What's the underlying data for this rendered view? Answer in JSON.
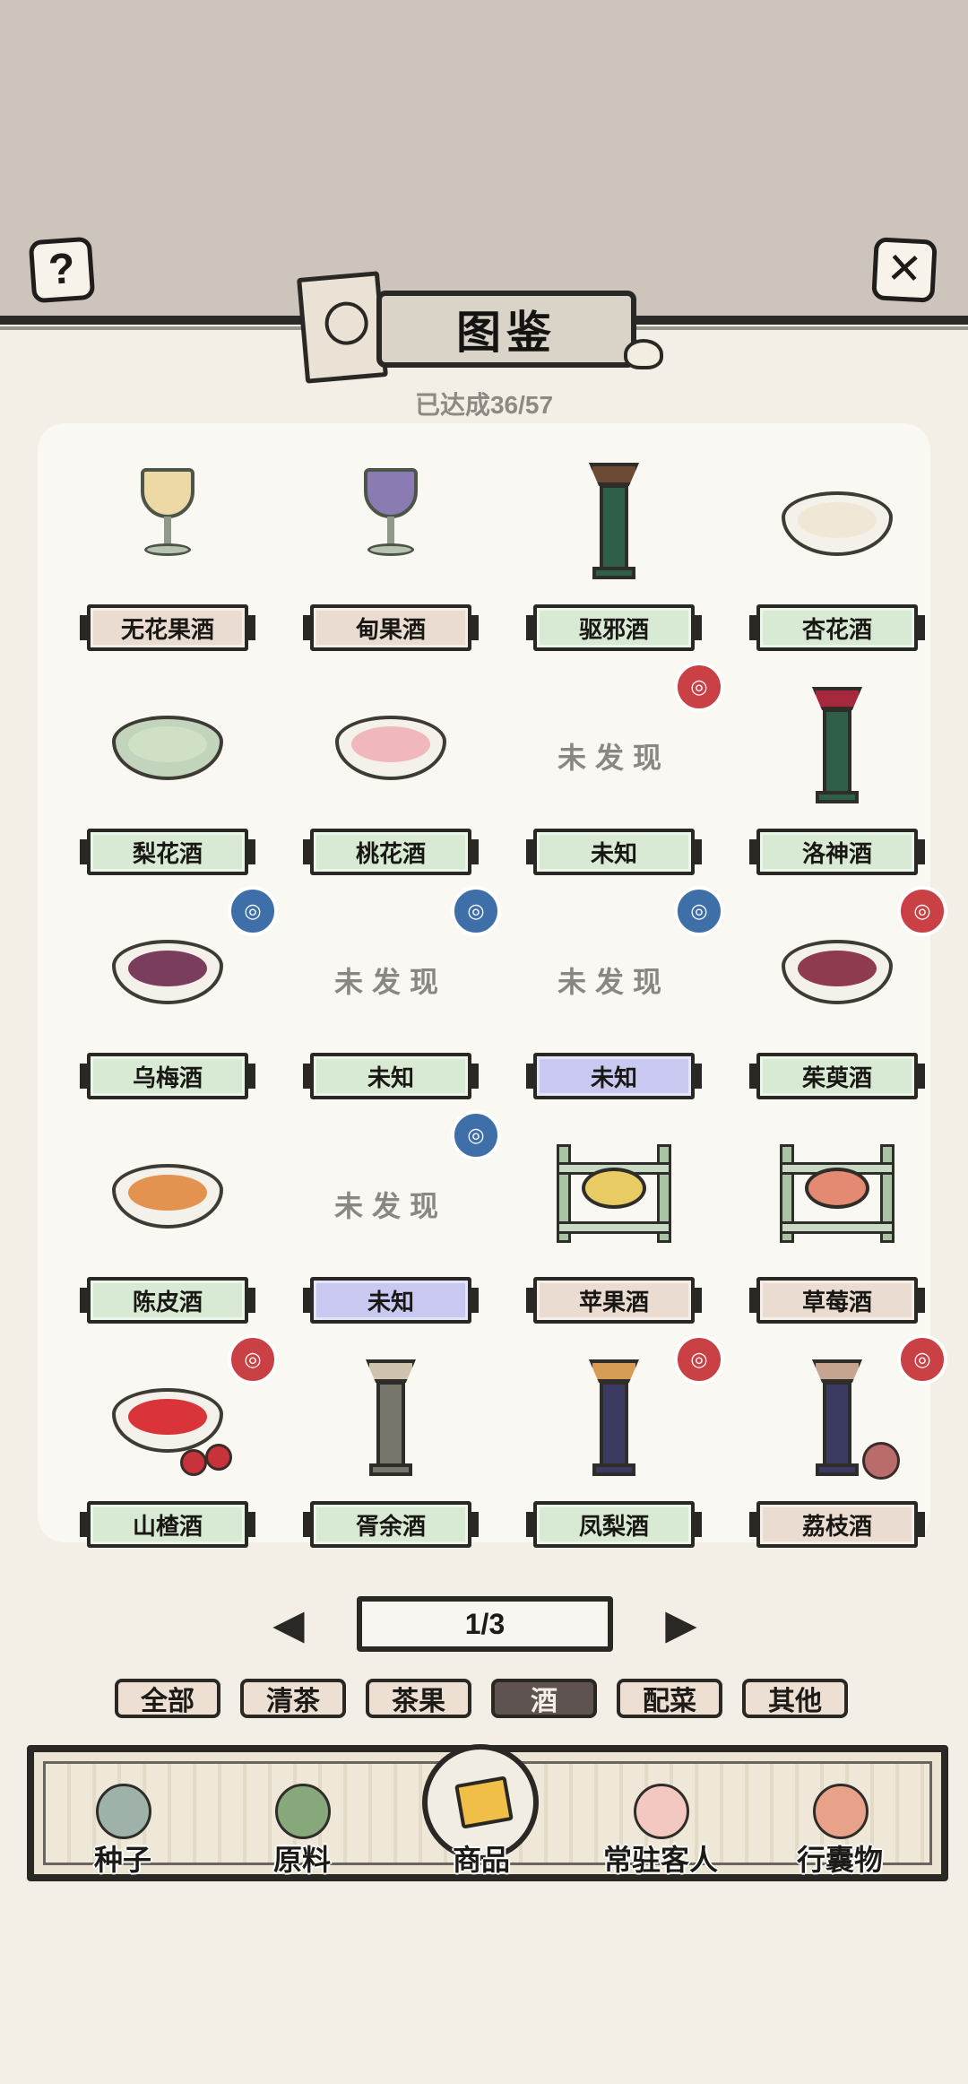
{
  "header": {
    "help_label": "?",
    "close_label": "✕",
    "title": "图鉴",
    "progress": "已达成36/57"
  },
  "grid": {
    "undiscovered_text": "未发现",
    "items": [
      {
        "name": "无花果酒",
        "plate": "brown",
        "icon": "goblet-icon",
        "liquid": "#ecd9a6",
        "badge": ""
      },
      {
        "name": "甸果酒",
        "plate": "brown",
        "icon": "goblet-icon",
        "liquid": "#8b7bb3",
        "badge": ""
      },
      {
        "name": "驱邪酒",
        "plate": "green",
        "icon": "vase-icon",
        "liquid": "#6c4a34",
        "badge": ""
      },
      {
        "name": "杏花酒",
        "plate": "green",
        "icon": "bowl-icon",
        "liquid": "#f1e7d6",
        "badge": ""
      },
      {
        "name": "梨花酒",
        "plate": "green",
        "icon": "teacup-icon",
        "liquid": "#cfe0c5",
        "badge": ""
      },
      {
        "name": "桃花酒",
        "plate": "green",
        "icon": "bowl-icon",
        "liquid": "#f0b8bd",
        "badge": ""
      },
      {
        "name": "未知",
        "plate": "green",
        "icon": "",
        "liquid": "",
        "badge": "red"
      },
      {
        "name": "洛神酒",
        "plate": "green",
        "icon": "vase-icon",
        "liquid": "#a5283c",
        "badge": ""
      },
      {
        "name": "乌梅酒",
        "plate": "green",
        "icon": "bowl-icon",
        "liquid": "#7a3e5c",
        "badge": "blue"
      },
      {
        "name": "未知",
        "plate": "green",
        "icon": "",
        "liquid": "",
        "badge": "blue"
      },
      {
        "name": "未知",
        "plate": "purple",
        "icon": "",
        "liquid": "",
        "badge": "blue"
      },
      {
        "name": "茱萸酒",
        "plate": "green",
        "icon": "bowl-icon",
        "liquid": "#8f3b4f",
        "badge": "red"
      },
      {
        "name": "陈皮酒",
        "plate": "green",
        "icon": "bowl-icon",
        "liquid": "#e3924f",
        "badge": ""
      },
      {
        "name": "未知",
        "plate": "purple",
        "icon": "",
        "liquid": "",
        "badge": "blue"
      },
      {
        "name": "苹果酒",
        "plate": "brown",
        "icon": "stand-icon",
        "liquid": "#e8cc63",
        "badge": ""
      },
      {
        "name": "草莓酒",
        "plate": "brown",
        "icon": "stand-icon",
        "liquid": "#e58a72",
        "badge": ""
      },
      {
        "name": "山楂酒",
        "plate": "green",
        "icon": "bowl-icon",
        "liquid": "#d8343a",
        "badge": "red"
      },
      {
        "name": "胥余酒",
        "plate": "green",
        "icon": "vase-icon",
        "liquid": "#cfc3ae",
        "badge": ""
      },
      {
        "name": "凤梨酒",
        "plate": "green",
        "icon": "vase-icon",
        "liquid": "#d69b55",
        "badge": "red"
      },
      {
        "name": "荔枝酒",
        "plate": "brown",
        "icon": "vase-icon",
        "liquid": "#c5a58f",
        "badge": "red"
      }
    ]
  },
  "pager": {
    "page": "1/3",
    "prev": "◀",
    "next": "▶"
  },
  "tabs": [
    {
      "label": "全部",
      "active": false
    },
    {
      "label": "清茶",
      "active": false
    },
    {
      "label": "茶果",
      "active": false
    },
    {
      "label": "酒",
      "active": true
    },
    {
      "label": "配菜",
      "active": false
    },
    {
      "label": "其他",
      "active": false
    }
  ],
  "nav": [
    {
      "label": "种子",
      "icon": "jar-icon",
      "color": "#9fb2a9"
    },
    {
      "label": "原料",
      "icon": "leaf-icon",
      "color": "#86a87a"
    },
    {
      "label": "商品",
      "icon": "cake-plate-icon",
      "color": "#f1bf48"
    },
    {
      "label": "常驻客人",
      "icon": "girl-avatar-icon",
      "color": "#f3c8c0"
    },
    {
      "label": "行囊物",
      "icon": "robe-icon",
      "color": "#e8a28a"
    }
  ],
  "colors": {
    "plate_brown": "#eadcd1",
    "plate_green": "#d9ead4",
    "plate_purple": "#c8c8f0",
    "badge_red": "#c94144",
    "badge_blue": "#3f6fa8",
    "active_tab": "#5e5350"
  }
}
